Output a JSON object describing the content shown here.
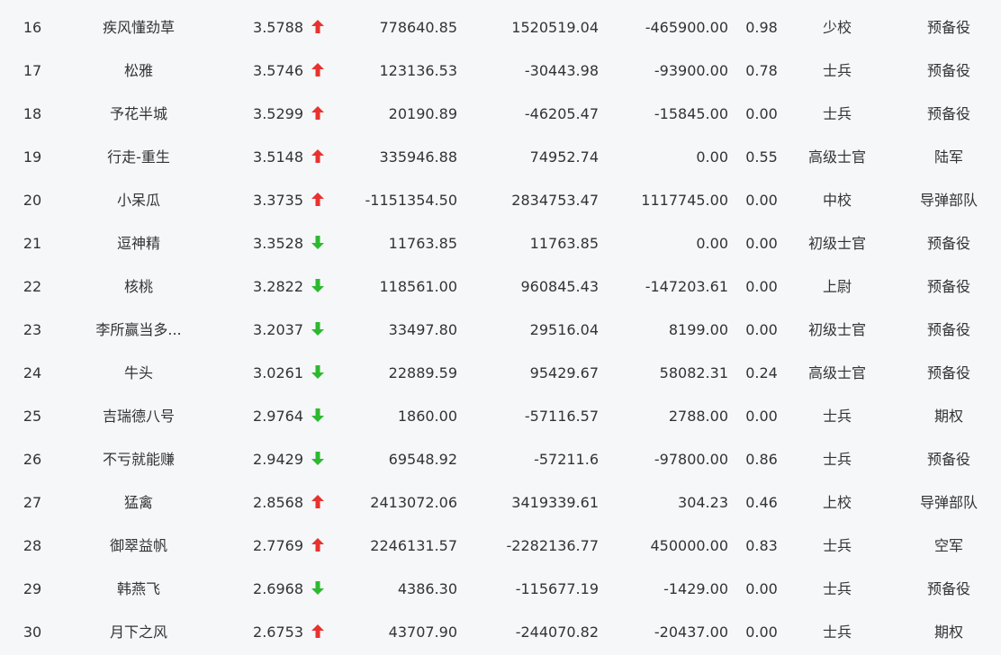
{
  "colors": {
    "up": "#e8322f",
    "down": "#2db92f",
    "text": "#333333",
    "background": "#f5f7f9"
  },
  "rows": [
    {
      "rank": "16",
      "name": "疾风懂劲草",
      "score": "3.5788",
      "trend": "up",
      "v1": "778640.85",
      "v2": "1520519.04",
      "v3": "-465900.00",
      "ratio": "0.98",
      "title": "少校",
      "team": "预备役"
    },
    {
      "rank": "17",
      "name": "松雅",
      "score": "3.5746",
      "trend": "up",
      "v1": "123136.53",
      "v2": "-30443.98",
      "v3": "-93900.00",
      "ratio": "0.78",
      "title": "士兵",
      "team": "预备役"
    },
    {
      "rank": "18",
      "name": "予花半城",
      "score": "3.5299",
      "trend": "up",
      "v1": "20190.89",
      "v2": "-46205.47",
      "v3": "-15845.00",
      "ratio": "0.00",
      "title": "士兵",
      "team": "预备役"
    },
    {
      "rank": "19",
      "name": "行走-重生",
      "score": "3.5148",
      "trend": "up",
      "v1": "335946.88",
      "v2": "74952.74",
      "v3": "0.00",
      "ratio": "0.55",
      "title": "高级士官",
      "team": "陆军"
    },
    {
      "rank": "20",
      "name": "小呆瓜",
      "score": "3.3735",
      "trend": "up",
      "v1": "-1151354.50",
      "v2": "2834753.47",
      "v3": "1117745.00",
      "ratio": "0.00",
      "title": "中校",
      "team": "导弹部队"
    },
    {
      "rank": "21",
      "name": "逗神精",
      "score": "3.3528",
      "trend": "down",
      "v1": "11763.85",
      "v2": "11763.85",
      "v3": "0.00",
      "ratio": "0.00",
      "title": "初级士官",
      "team": "预备役"
    },
    {
      "rank": "22",
      "name": "核桃",
      "score": "3.2822",
      "trend": "down",
      "v1": "118561.00",
      "v2": "960845.43",
      "v3": "-147203.61",
      "ratio": "0.00",
      "title": "上尉",
      "team": "预备役"
    },
    {
      "rank": "23",
      "name": "李所赢当多...",
      "score": "3.2037",
      "trend": "down",
      "v1": "33497.80",
      "v2": "29516.04",
      "v3": "8199.00",
      "ratio": "0.00",
      "title": "初级士官",
      "team": "预备役"
    },
    {
      "rank": "24",
      "name": "牛头",
      "score": "3.0261",
      "trend": "down",
      "v1": "22889.59",
      "v2": "95429.67",
      "v3": "58082.31",
      "ratio": "0.24",
      "title": "高级士官",
      "team": "预备役"
    },
    {
      "rank": "25",
      "name": "吉瑞德八号",
      "score": "2.9764",
      "trend": "down",
      "v1": "1860.00",
      "v2": "-57116.57",
      "v3": "2788.00",
      "ratio": "0.00",
      "title": "士兵",
      "team": "期权"
    },
    {
      "rank": "26",
      "name": "不亏就能赚",
      "score": "2.9429",
      "trend": "down",
      "v1": "69548.92",
      "v2": "-57211.6",
      "v3": "-97800.00",
      "ratio": "0.86",
      "title": "士兵",
      "team": "预备役"
    },
    {
      "rank": "27",
      "name": "猛禽",
      "score": "2.8568",
      "trend": "up",
      "v1": "2413072.06",
      "v2": "3419339.61",
      "v3": "304.23",
      "ratio": "0.46",
      "title": "上校",
      "team": "导弹部队"
    },
    {
      "rank": "28",
      "name": "御翠益帆",
      "score": "2.7769",
      "trend": "up",
      "v1": "2246131.57",
      "v2": "-2282136.77",
      "v3": "450000.00",
      "ratio": "0.83",
      "title": "士兵",
      "team": "空军"
    },
    {
      "rank": "29",
      "name": "韩燕飞",
      "score": "2.6968",
      "trend": "down",
      "v1": "4386.30",
      "v2": "-115677.19",
      "v3": "-1429.00",
      "ratio": "0.00",
      "title": "士兵",
      "team": "预备役"
    },
    {
      "rank": "30",
      "name": "月下之风",
      "score": "2.6753",
      "trend": "up",
      "v1": "43707.90",
      "v2": "-244070.82",
      "v3": "-20437.00",
      "ratio": "0.00",
      "title": "士兵",
      "team": "期权"
    }
  ]
}
